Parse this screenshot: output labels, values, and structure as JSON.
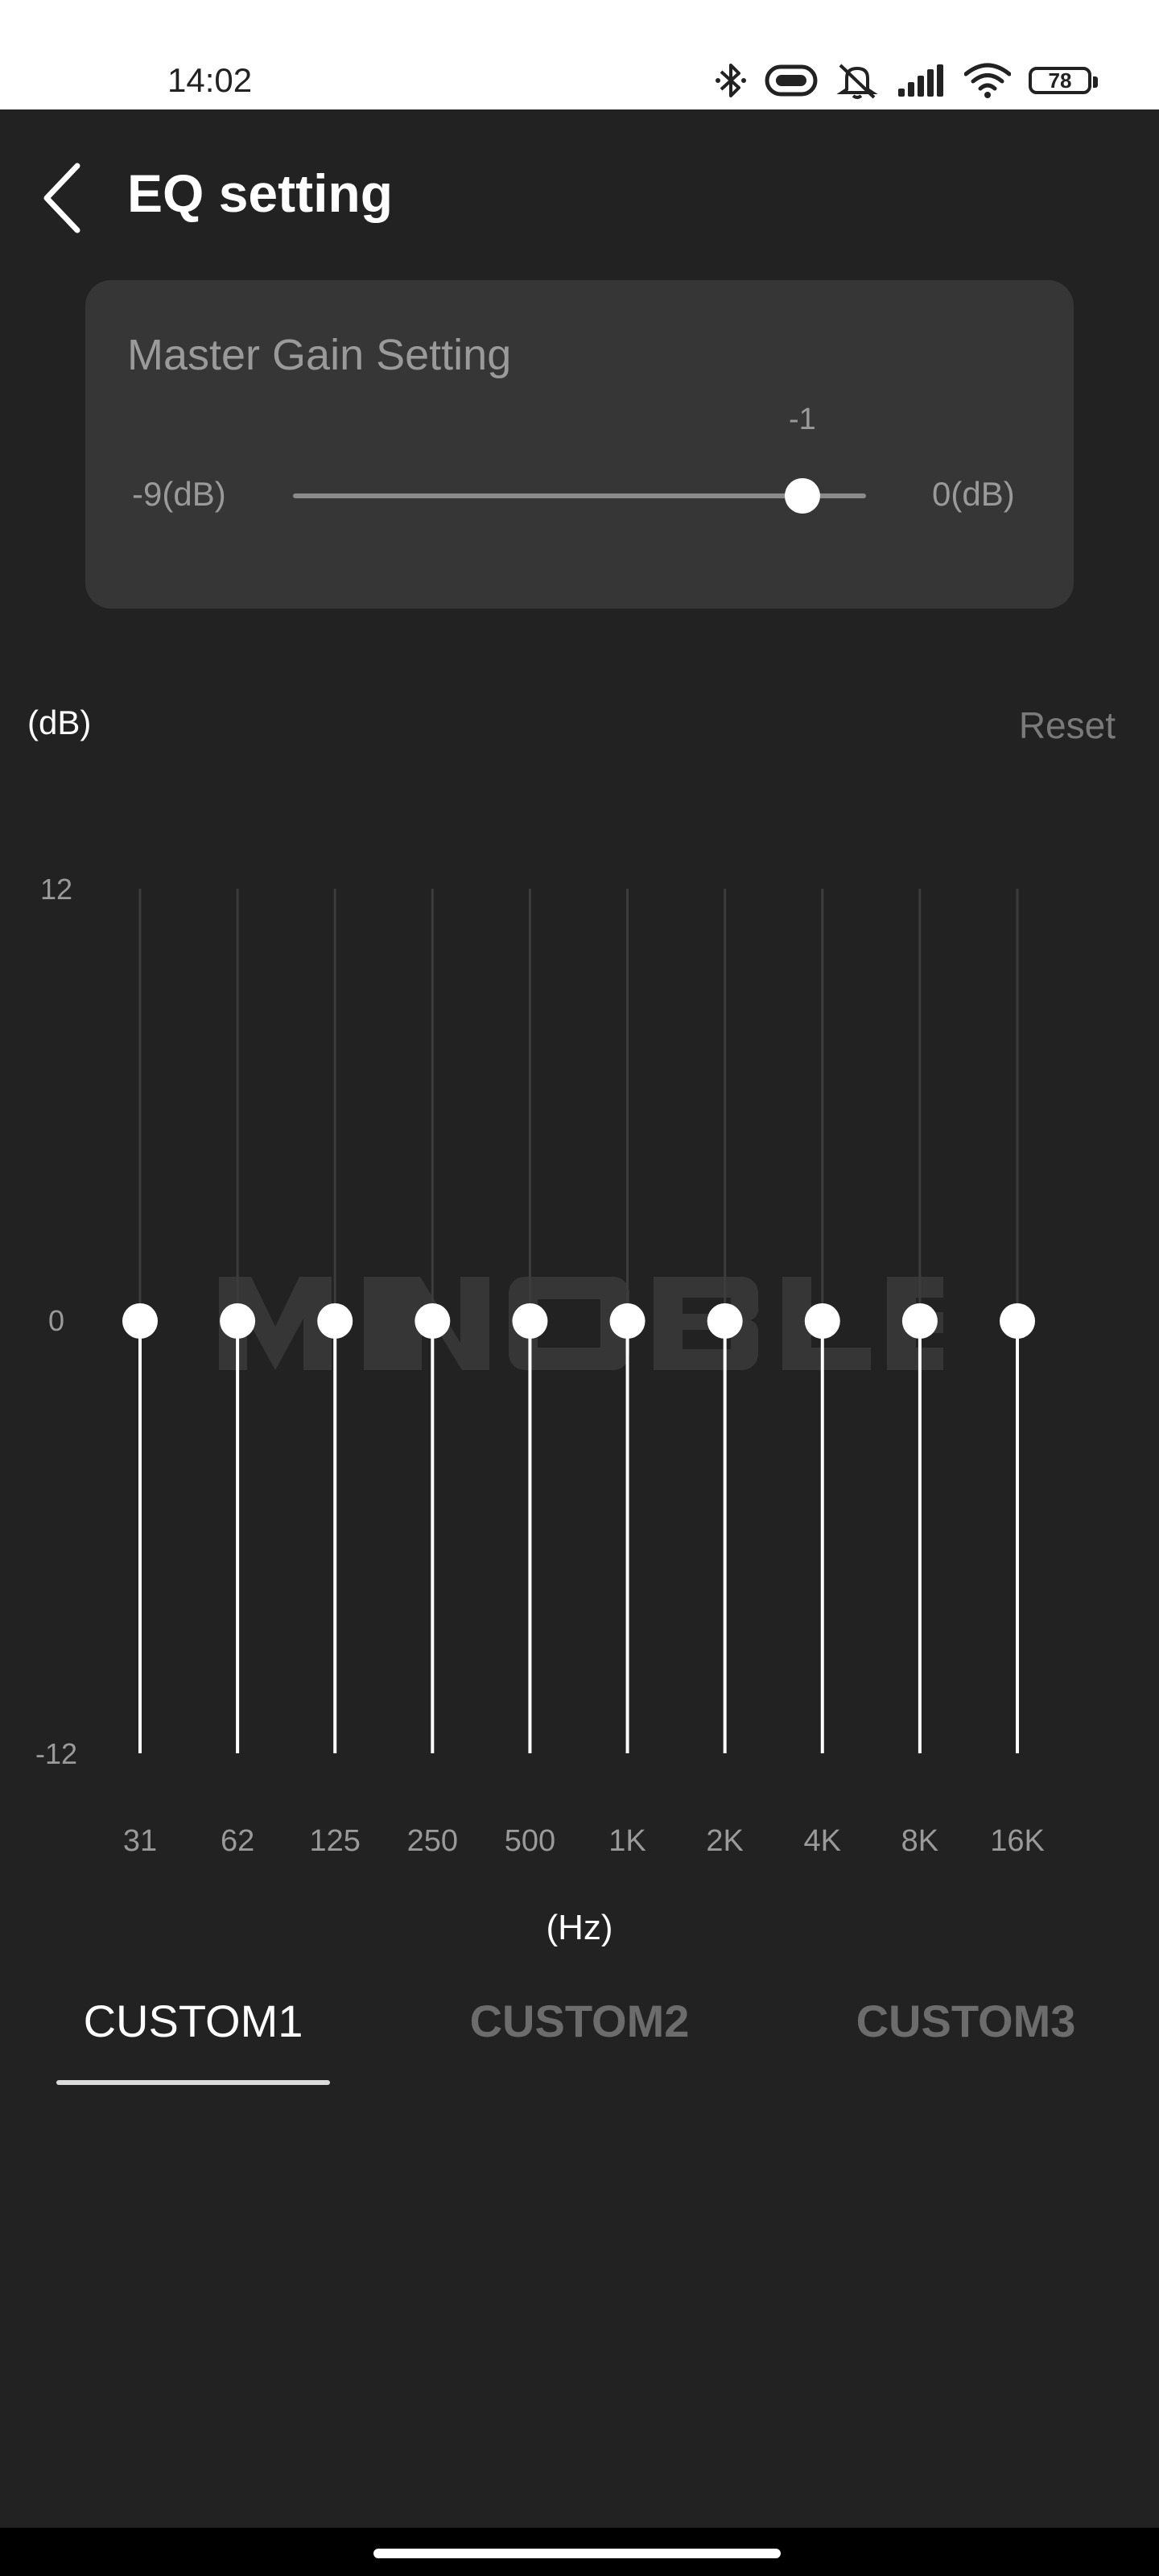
{
  "status_bar": {
    "time": "14:02",
    "battery": "78",
    "icons": [
      "bluetooth-icon",
      "headphone-case-icon",
      "mute-icon",
      "signal-icon",
      "wifi-icon",
      "battery-icon"
    ]
  },
  "header": {
    "title": "EQ setting",
    "back_icon": "chevron-left-icon"
  },
  "master_gain": {
    "title": "Master Gain Setting",
    "min_label": "-9(dB)",
    "max_label": "0(dB)",
    "min": -9,
    "max": 0,
    "value": -1,
    "value_label": "-1"
  },
  "eq": {
    "unit_label": "(dB)",
    "reset_label": "Reset",
    "y_ticks": [
      "12",
      "0",
      "-12"
    ],
    "y_range": [
      -12,
      12
    ],
    "x_unit_label": "(Hz)",
    "watermark": "NOBLE",
    "bands": [
      {
        "label": "31",
        "value": 0
      },
      {
        "label": "62",
        "value": 0
      },
      {
        "label": "125",
        "value": 0
      },
      {
        "label": "250",
        "value": 0
      },
      {
        "label": "500",
        "value": 0
      },
      {
        "label": "1K",
        "value": 0
      },
      {
        "label": "2K",
        "value": 0
      },
      {
        "label": "4K",
        "value": 0
      },
      {
        "label": "8K",
        "value": 0
      },
      {
        "label": "16K",
        "value": 0
      }
    ]
  },
  "presets": {
    "tabs": [
      "CUSTOM1",
      "CUSTOM2",
      "CUSTOM3"
    ],
    "active_index": 0
  },
  "colors": {
    "background": "#222222",
    "card": "#363636",
    "accent": "#ffffff",
    "muted_text": "#9a9a9a"
  }
}
